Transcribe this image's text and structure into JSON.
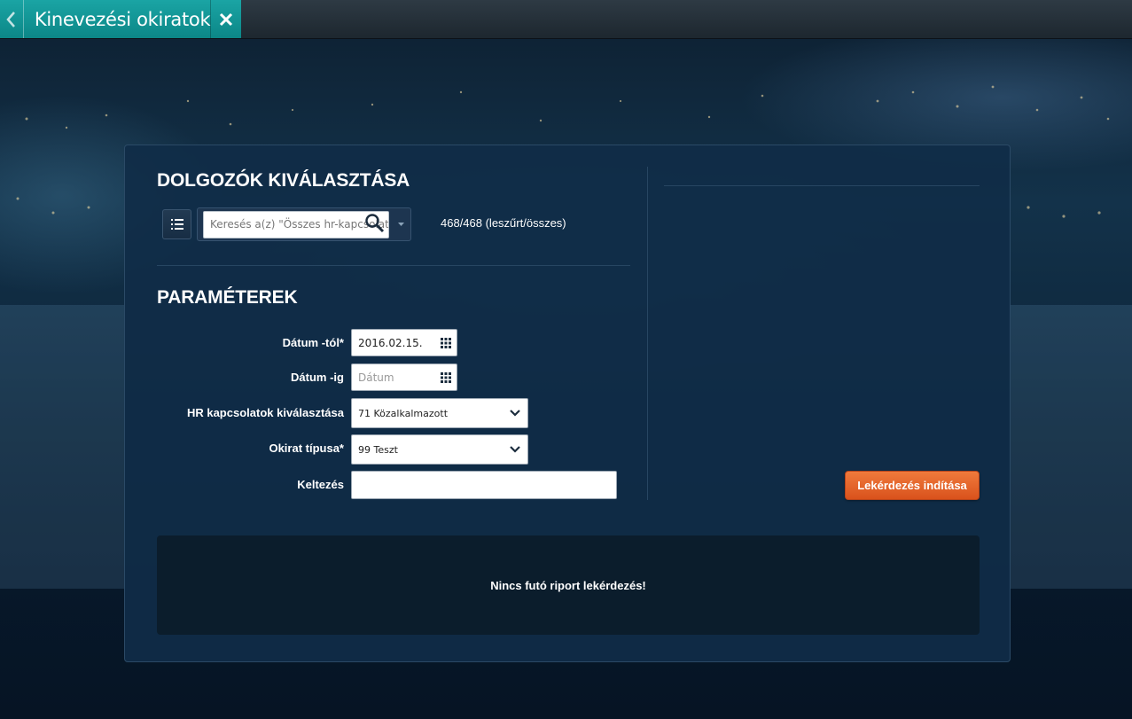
{
  "window": {
    "title": "Kinevezési okiratok",
    "back_icon": "chevron-left-icon",
    "close_icon": "close-icon"
  },
  "employees": {
    "section_title": "DOLGOZÓK KIVÁLASZTÁSA",
    "list_icon": "list-icon",
    "search_placeholder": "Keresés a(z) \"Összes hr-kapcsolat\"",
    "count_text": "468/468 (leszűrt/összes)"
  },
  "params": {
    "section_title": "PARAMÉTEREK",
    "date_from": {
      "label": "Dátum -tól*",
      "value": "2016.02.15."
    },
    "date_to": {
      "label": "Dátum -ig",
      "placeholder": "Dátum",
      "value": ""
    },
    "hr_relations": {
      "label": "HR kapcsolatok kiválasztása",
      "value": "71 Közalkalmazott"
    },
    "doc_type": {
      "label": "Okirat típusa*",
      "value": "99 Teszt"
    },
    "issued": {
      "label": "Keltezés",
      "value": ""
    }
  },
  "actions": {
    "run_label": "Lekérdezés indítása"
  },
  "status": {
    "message": "Nincs futó riport lekérdezés!"
  },
  "colors": {
    "accent": "#129999",
    "run_button": "#e4632a",
    "panel": "#102d48"
  }
}
